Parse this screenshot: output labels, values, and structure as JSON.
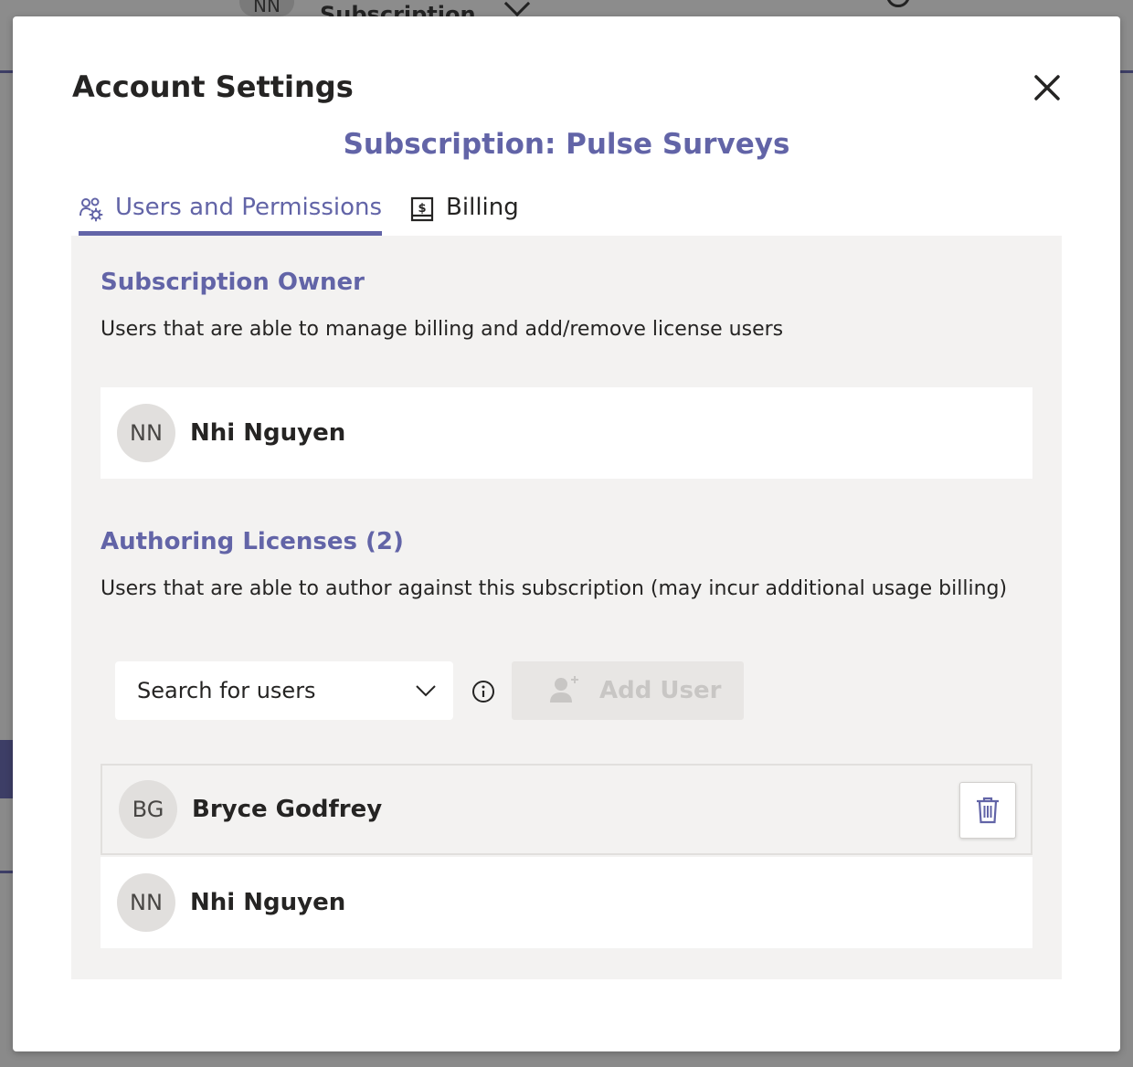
{
  "background": {
    "avatar_initials": "NN",
    "subtitle": "Subscription"
  },
  "modal": {
    "title": "Account Settings",
    "subheading": "Subscription: Pulse Surveys",
    "close_icon": "close-icon"
  },
  "tabs": [
    {
      "label": "Users and Permissions",
      "icon": "users-settings-icon",
      "active": true
    },
    {
      "label": "Billing",
      "icon": "billing-receipt-icon",
      "active": false
    }
  ],
  "owner_section": {
    "title": "Subscription Owner",
    "description": "Users that are able to manage billing and add/remove license users",
    "users": [
      {
        "initials": "NN",
        "name": "Nhi Nguyen"
      }
    ]
  },
  "licenses_section": {
    "title": "Authoring Licenses (2)",
    "description": "Users that are able to author against this subscription (may incur additional usage billing)",
    "search_placeholder": "Search for users",
    "add_user_label": "Add User",
    "users": [
      {
        "initials": "BG",
        "name": "Bryce Godfrey",
        "selected": true
      },
      {
        "initials": "NN",
        "name": "Nhi Nguyen",
        "selected": false
      }
    ]
  },
  "colors": {
    "accent": "#6264a7",
    "panel_bg": "#f3f2f1",
    "avatar_bg": "#e1dfdd"
  }
}
